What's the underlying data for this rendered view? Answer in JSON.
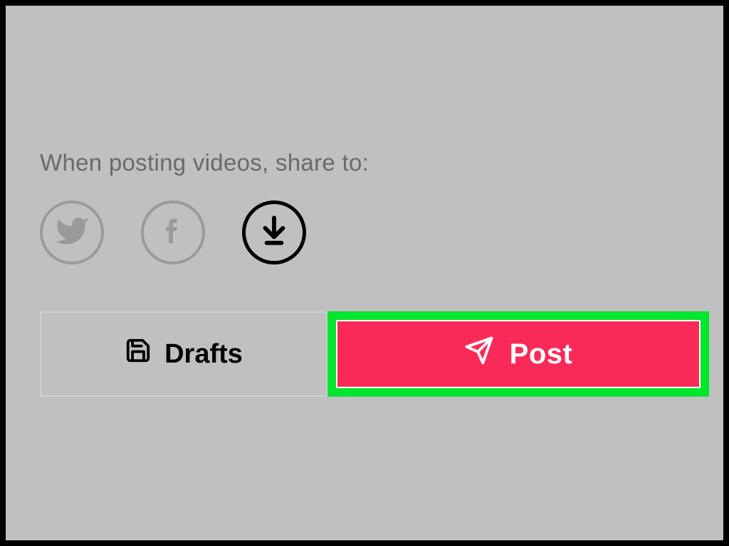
{
  "share": {
    "label": "When posting videos, share to:",
    "options": {
      "twitter": "twitter",
      "facebook": "facebook",
      "download": "download"
    }
  },
  "buttons": {
    "drafts": "Drafts",
    "post": "Post"
  },
  "colors": {
    "highlight": "#00e62e",
    "post_bg": "#fa2a58",
    "panel": "#c0c0c0",
    "inactive": "#9a9a9a"
  }
}
